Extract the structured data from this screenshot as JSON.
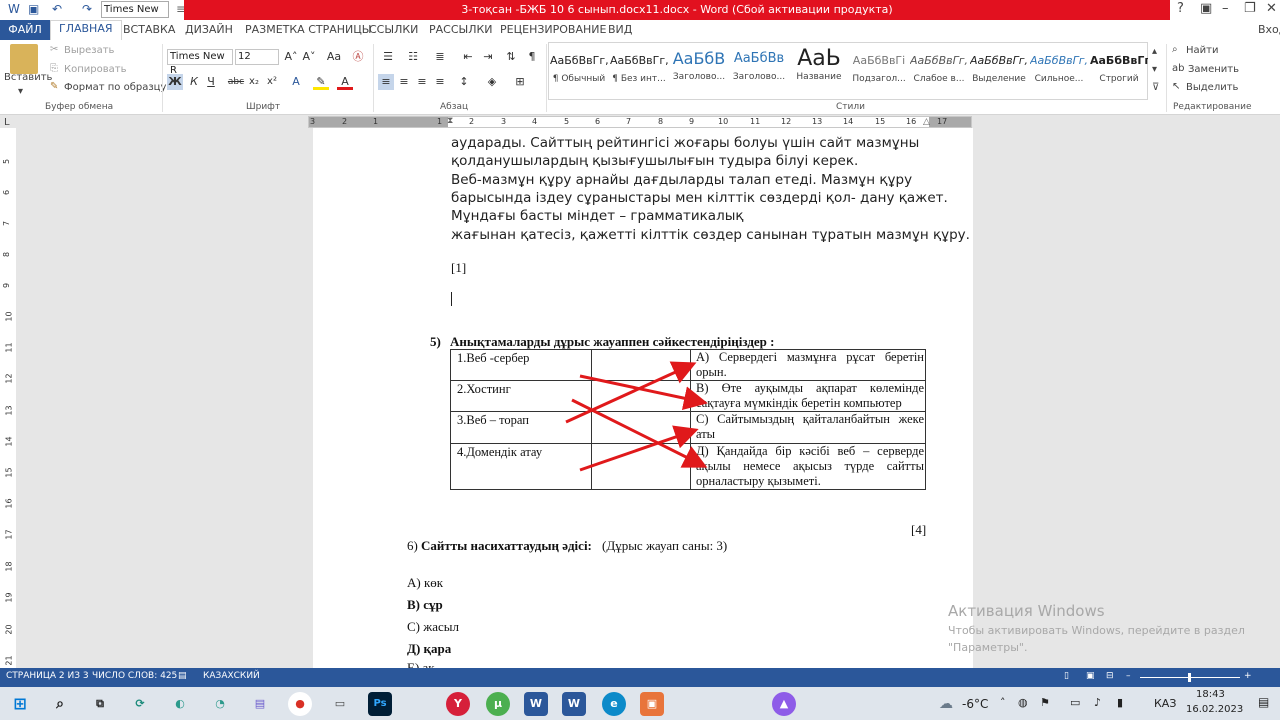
{
  "titlebar": {
    "title": "3-тоқсан -БЖБ 10 6 сынып.docx11.docx -  Word (Сбой активации продукта)",
    "font_name": "Times New R",
    "help": "?",
    "minimize": "–",
    "restore": "❐",
    "close": "✕"
  },
  "tabs": [
    "ФАЙЛ",
    "ГЛАВНАЯ",
    "ВСТАВКА",
    "ДИЗАЙН",
    "РАЗМЕТКА СТРАНИЦЫ",
    "ССЫЛКИ",
    "РАССЫЛКИ",
    "РЕЦЕНЗИРОВАНИЕ",
    "ВИД"
  ],
  "signin": "Вход",
  "clipboard": {
    "paste": "Вставить",
    "cut": "Вырезать",
    "copy": "Копировать",
    "format_painter": "Формат по образцу",
    "label": "Буфер обмена"
  },
  "font": {
    "name": "Times New R",
    "size": "12",
    "bold": "Ж",
    "italic": "К",
    "underline": "Ч",
    "strike": "abc",
    "sub": "x₂",
    "sup": "x²",
    "label": "Шрифт",
    "grow": "A˄",
    "shrink": "A˅",
    "case": "Aa",
    "clear": "A"
  },
  "paragraph": {
    "label": "Абзац"
  },
  "styles": {
    "label": "Стили",
    "items": [
      {
        "preview": "АаБбВвГг,",
        "name": "¶ Обычный"
      },
      {
        "preview": "АаБбВвГг,",
        "name": "¶ Без инт..."
      },
      {
        "preview": "АаБбВ",
        "name": "Заголово..."
      },
      {
        "preview": "АаБбВв",
        "name": "Заголово..."
      },
      {
        "preview": "АаЬ",
        "name": "Название"
      },
      {
        "preview": "АаБбВвГі",
        "name": "Подзагол..."
      },
      {
        "preview": "АаБбВвГг,",
        "name": "Слабое в..."
      },
      {
        "preview": "АаБбВвГг,",
        "name": "Выделение"
      },
      {
        "preview": "АаБбВвГг,",
        "name": "Сильное..."
      },
      {
        "preview": "АаБбВвГг,",
        "name": "Строгий"
      }
    ]
  },
  "editing": {
    "find": "Найти",
    "replace": "Заменить",
    "select": "Выделить",
    "label": "Редактирование"
  },
  "ruler": {
    "h": [
      "3",
      "2",
      "1",
      "1",
      "2",
      "3",
      "4",
      "5",
      "6",
      "7",
      "8",
      "9",
      "10",
      "11",
      "12",
      "13",
      "14",
      "15",
      "16",
      "17"
    ],
    "v": [
      "5",
      "6",
      "7",
      "8",
      "9",
      "10",
      "11",
      "12",
      "13",
      "14",
      "15",
      "16",
      "17",
      "18",
      "19",
      "20",
      "21"
    ]
  },
  "doc": {
    "lines": [
      "аударады. Сайттың рейтингісі жоғары болуы үшін сайт мазмұны",
      "қолданушылардың қызығушылығын тудыра білуі керек.",
      "Веб-мазмұн құру арнайы дағдыларды талап етеді. Мазмұн құру",
      "барысында іздеу сұраныстары мен кілттік сөздерді қол- дану қажет.",
      "Мұндағы басты міндет – грамматикалық",
      "жағынан қатесіз, қажетті кілттік сөздер санынан тұратын мазмұн құру."
    ],
    "mark1": "[1]",
    "q5_num": "5)",
    "q5_title": "Анықтамаларды дұрыс жауаппен сәйкестендіріңіздер :",
    "table_left": [
      "1.Веб -сербер",
      "2.Хостинг",
      "3.Веб – торап",
      "4.Домендік атау"
    ],
    "table_right": [
      "А) Сервердегі мазмұнға рұсат беретін орын.",
      "В) Өте ауқымды ақпарат көлемінде сақтауға мүмкіндік беретін компьютер",
      "С) Сайтымыздың қайталанбайтын жеке аты",
      "Д) Қандайда бір кәсібі веб – серверде ақылы немесе ақысыз түрде сайтты орналастыру қызыметі."
    ],
    "mark4": "[4]",
    "q6_num": "6)",
    "q6_title": "Сайтты насихаттаудың әдісі:",
    "q6_note": "(Дұрыс жауап саны: 3)",
    "options": [
      {
        "text": "А) көк",
        "bold": false
      },
      {
        "text": "В) сұр",
        "bold": true
      },
      {
        "text": "С) жасыл",
        "bold": false
      },
      {
        "text": "Д) қара",
        "bold": true
      },
      {
        "text": "Е) ақ",
        "bold": false
      }
    ]
  },
  "statusbar": {
    "page": "СТРАНИЦА 2 ИЗ 3",
    "words": "ЧИСЛО СЛОВ: 425",
    "lang": "КАЗАХСКИЙ"
  },
  "activation": {
    "title": "Активация Windows",
    "line1": "Чтобы активировать Windows, перейдите в раздел",
    "line2": "\"Параметры\"."
  },
  "taskbar": {
    "weather": "-6°C",
    "lang": "КАЗ",
    "time": "18:43",
    "date": "16.02.2023"
  },
  "colors": {
    "accent": "#2b579a",
    "title_red": "#e2111f",
    "arrow_red": "#e0191b"
  }
}
